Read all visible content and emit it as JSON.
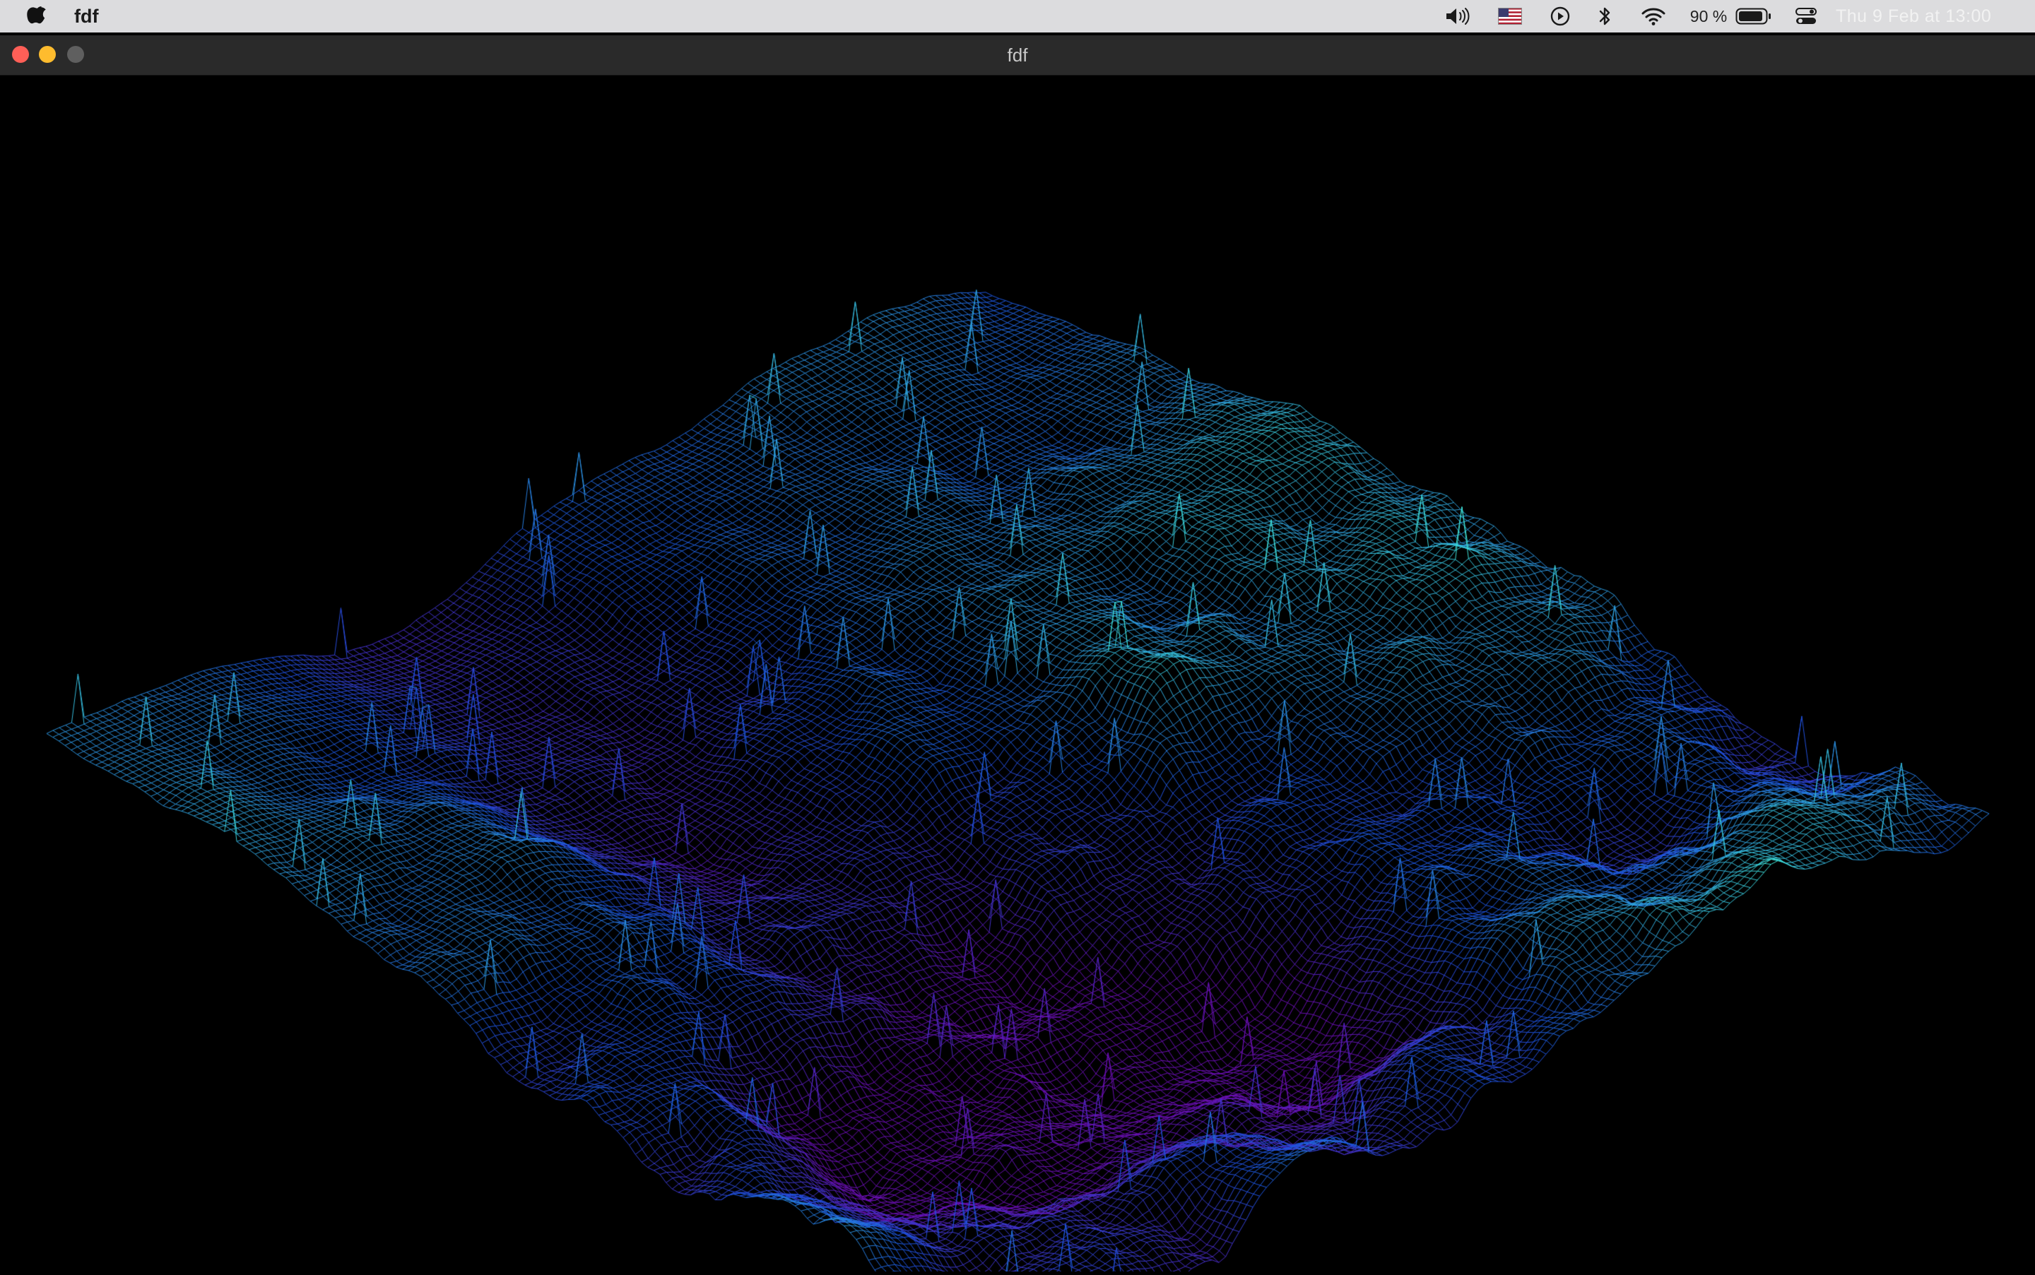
{
  "menubar": {
    "app_name": "fdf",
    "icons": [
      "apple-icon",
      "volume-icon",
      "us-flag-icon",
      "play-icon",
      "bluetooth-icon",
      "wifi-icon",
      "battery-icon",
      "control-center-icon"
    ],
    "battery_percent": "90 %",
    "clock": "Thu 9 Feb at  13:00"
  },
  "window": {
    "title": "fdf",
    "traffic_lights": {
      "close_color": "#ff5f57",
      "minimize_color": "#febc2e",
      "zoom_color": "#5f5f5f"
    }
  },
  "render": {
    "type": "isometric wireframe heightmap",
    "palette": {
      "low": "#6a0fb3",
      "mid": "#1d55e0",
      "high": "#3fe3d8"
    },
    "background": "#000000"
  }
}
